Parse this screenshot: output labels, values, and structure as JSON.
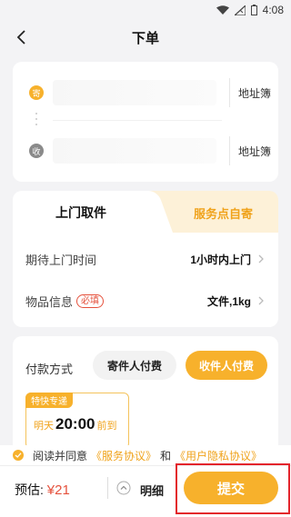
{
  "status_bar": {
    "time": "4:08"
  },
  "nav": {
    "title": "下单"
  },
  "address": {
    "sender_badge": "寄",
    "receiver_badge": "收",
    "book_label": "地址簿"
  },
  "tabs": {
    "door_pickup": "上门取件",
    "self_drop": "服务点自寄"
  },
  "info": {
    "pickup_time_label": "期待上门时间",
    "pickup_time_value": "1小时内上门",
    "item_label": "物品信息",
    "required_tag": "必填",
    "item_value": "文件,1kg"
  },
  "payment": {
    "label": "付款方式",
    "sender_pays": "寄件人付费",
    "receiver_pays": "收件人付费"
  },
  "service": {
    "tag": "特快专递",
    "day": "明天",
    "time": "20:00",
    "suffix": "前到"
  },
  "agreement": {
    "prefix": "阅读并同意",
    "service_link": "《服务协议》",
    "and": "和",
    "privacy_link": "《用户隐私协议》"
  },
  "bottom": {
    "estimate_label": "预估:",
    "price": "¥21",
    "detail": "明细",
    "submit": "提交"
  },
  "colors": {
    "accent": "#f7b12c",
    "price": "#e5513c",
    "highlight": "#e3242b"
  }
}
